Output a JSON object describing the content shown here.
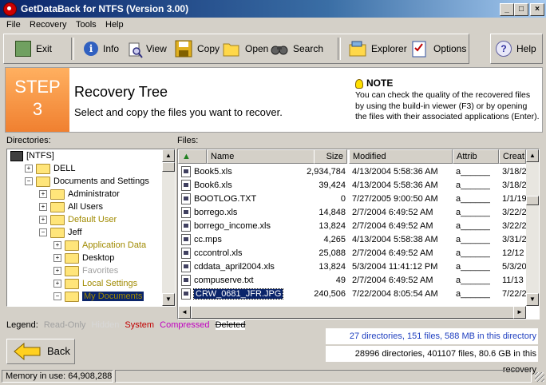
{
  "window": {
    "title": "GetDataBack for NTFS (Version 3.00)"
  },
  "menu": [
    "File",
    "Recovery",
    "Tools",
    "Help"
  ],
  "toolbar": {
    "exit": "Exit",
    "info": "Info",
    "view": "View",
    "copy": "Copy",
    "open": "Open",
    "search": "Search",
    "explorer": "Explorer",
    "options": "Options",
    "help": "Help"
  },
  "banner": {
    "step_label": "STEP",
    "step_number": "3",
    "title": "Recovery Tree",
    "subtitle": "Select and copy the files you want to recover.",
    "note_title": "NOTE",
    "note_text": "You can check the quality of the recovered files by using the build-in viewer (F3) or by opening the files with their associated applications (Enter)."
  },
  "directories_label": "Directories:",
  "files_label": "Files:",
  "tree": [
    {
      "label": "[NTFS]",
      "level": 0,
      "toggle": "",
      "style": "root"
    },
    {
      "label": "DELL",
      "level": 1,
      "toggle": "+",
      "style": "normal"
    },
    {
      "label": "Documents and Settings",
      "level": 1,
      "toggle": "-",
      "style": "normal"
    },
    {
      "label": "Administrator",
      "level": 2,
      "toggle": "+",
      "style": "normal"
    },
    {
      "label": "All Users",
      "level": 2,
      "toggle": "+",
      "style": "normal"
    },
    {
      "label": "Default User",
      "level": 2,
      "toggle": "+",
      "style": "hidden"
    },
    {
      "label": "Jeff",
      "level": 2,
      "toggle": "-",
      "style": "normal"
    },
    {
      "label": "Application Data",
      "level": 3,
      "toggle": "+",
      "style": "hidden"
    },
    {
      "label": "Desktop",
      "level": 3,
      "toggle": "+",
      "style": "normal"
    },
    {
      "label": "Favorites",
      "level": 3,
      "toggle": "+",
      "style": "readonly"
    },
    {
      "label": "Local Settings",
      "level": 3,
      "toggle": "+",
      "style": "hidden"
    },
    {
      "label": "My Documents",
      "level": 3,
      "toggle": "-",
      "style": "selected"
    }
  ],
  "files_columns": [
    "Name",
    "Size",
    "Modified",
    "Attrib",
    "Creat"
  ],
  "files": [
    {
      "name": "Book5.xls",
      "size": "2,934,784",
      "modified": "4/13/2004 5:58:36 AM",
      "attrib": "a______",
      "created": "3/18/2"
    },
    {
      "name": "Book6.xls",
      "size": "39,424",
      "modified": "4/13/2004 5:58:36 AM",
      "attrib": "a______",
      "created": "3/18/2"
    },
    {
      "name": "BOOTLOG.TXT",
      "size": "0",
      "modified": "7/27/2005 9:00:50 AM",
      "attrib": "a______",
      "created": "1/1/19"
    },
    {
      "name": "borrego.xls",
      "size": "14,848",
      "modified": "2/7/2004 6:49:52 AM",
      "attrib": "a______",
      "created": "3/22/2"
    },
    {
      "name": "borrego_income.xls",
      "size": "13,824",
      "modified": "2/7/2004 6:49:52 AM",
      "attrib": "a______",
      "created": "3/22/2"
    },
    {
      "name": "cc.mps",
      "size": "4,265",
      "modified": "4/13/2004 5:58:38 AM",
      "attrib": "a______",
      "created": "3/31/2"
    },
    {
      "name": "cccontrol.xls",
      "size": "25,088",
      "modified": "2/7/2004 6:49:52 AM",
      "attrib": "a______",
      "created": "12/12"
    },
    {
      "name": "cddata_april2004.xls",
      "size": "13,824",
      "modified": "5/3/2004 11:41:12 PM",
      "attrib": "a______",
      "created": "5/3/20"
    },
    {
      "name": "compuserve.txt",
      "size": "49",
      "modified": "2/7/2004 6:49:52 AM",
      "attrib": "a______",
      "created": "11/13"
    },
    {
      "name": "CRW_0681_JFR.JPG",
      "size": "240,506",
      "modified": "7/22/2004 8:05:54 AM",
      "attrib": "a______",
      "created": "7/22/2"
    }
  ],
  "legend": {
    "label": "Legend:",
    "read_only": "Read-Only",
    "hidden": "Hidden",
    "system": "System",
    "compressed": "Compressed",
    "deleted": "Deleted"
  },
  "back_button": "Back",
  "info": {
    "current": "27 directories, 151 files, 588 MB in this directory",
    "total": "28996 directories, 401107 files, 80.6 GB in this recovery"
  },
  "status": {
    "memory": "Memory in use: 64,908,288"
  },
  "colors": {
    "hidden": "#a08a00",
    "readonly": "#a0a0a0",
    "system": "#c00000",
    "compressed": "#c000c0",
    "selected_bg": "#0a246a",
    "step": "#f08030"
  }
}
